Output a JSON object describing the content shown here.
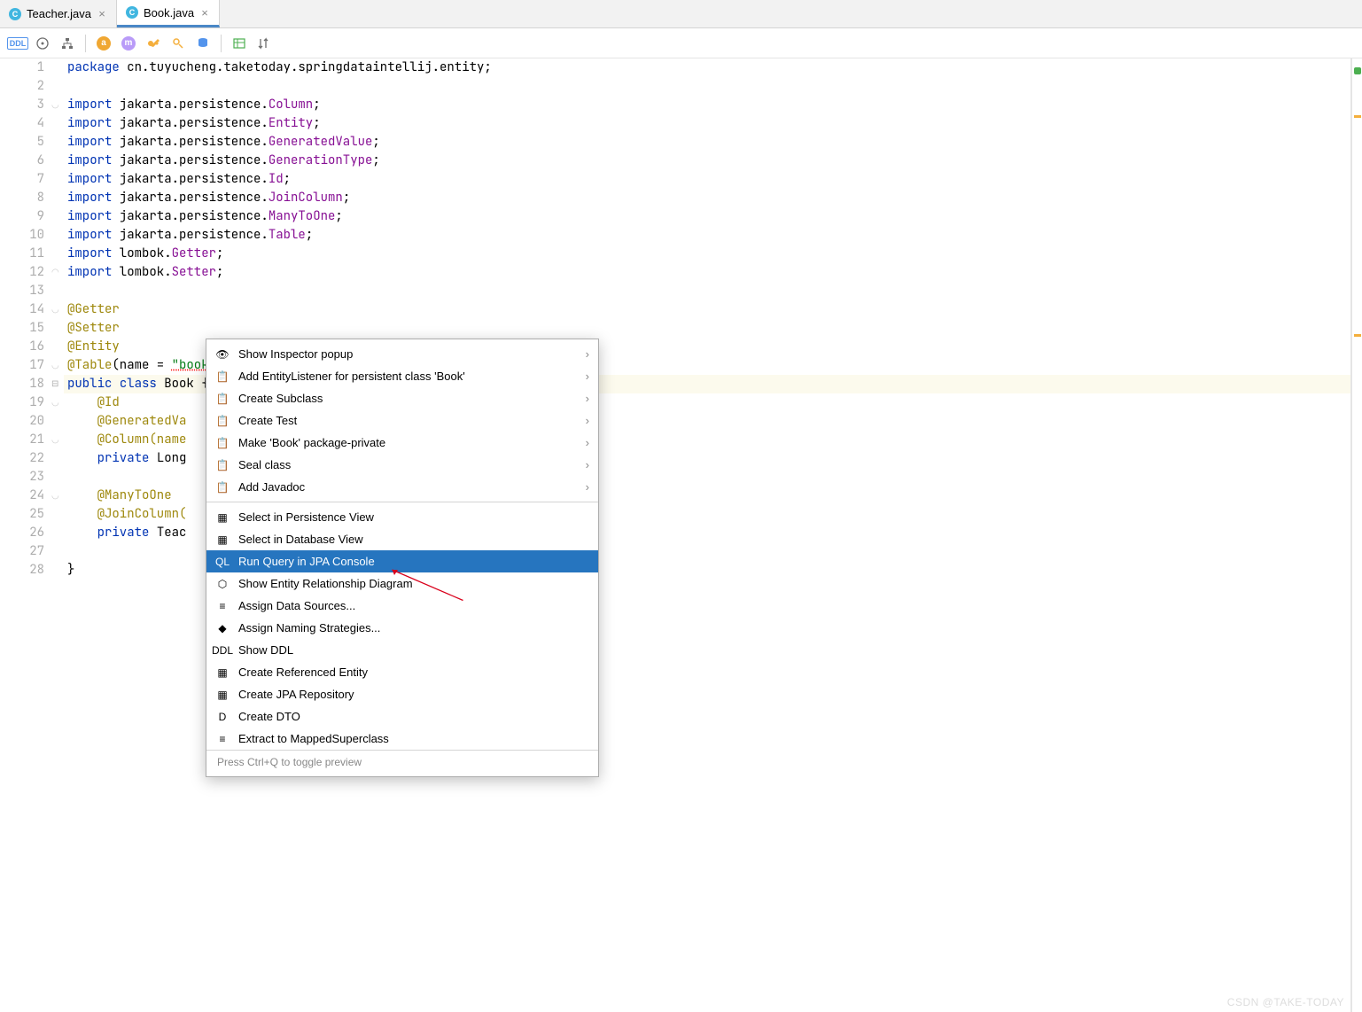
{
  "tabs": [
    {
      "icon": "C",
      "label": "Teacher.java",
      "active": false
    },
    {
      "icon": "C",
      "label": "Book.java",
      "active": true
    }
  ],
  "toolbar": {
    "ddl": "DDL"
  },
  "gutter_last": 28,
  "code": {
    "package_kw": "package",
    "package_val": " cn.tuyucheng.taketoday.springdataintellij.entity;",
    "import_kw": "import",
    "imports": [
      {
        "pkg": " jakarta.persistence.",
        "cls": "Column",
        "tail": ";"
      },
      {
        "pkg": " jakarta.persistence.",
        "cls": "Entity",
        "tail": ";"
      },
      {
        "pkg": " jakarta.persistence.",
        "cls": "GeneratedValue",
        "tail": ";"
      },
      {
        "pkg": " jakarta.persistence.",
        "cls": "GenerationType",
        "tail": ";"
      },
      {
        "pkg": " jakarta.persistence.",
        "cls": "Id",
        "tail": ";"
      },
      {
        "pkg": " jakarta.persistence.",
        "cls": "JoinColumn",
        "tail": ";"
      },
      {
        "pkg": " jakarta.persistence.",
        "cls": "ManyToOne",
        "tail": ";"
      },
      {
        "pkg": " jakarta.persistence.",
        "cls": "Table",
        "tail": ";"
      },
      {
        "pkg": " lombok.",
        "cls": "Getter",
        "tail": ";"
      },
      {
        "pkg": " lombok.",
        "cls": "Setter",
        "tail": ";"
      }
    ],
    "ann_getter": "@Getter",
    "ann_setter": "@Setter",
    "ann_entity": "@Entity",
    "ann_table_pre": "@Table",
    "ann_table_args_pre": "(name = ",
    "ann_table_str": "\"book\"",
    "ann_table_args_post": ")",
    "cls_decl_pre": "public class ",
    "cls_name": "Book",
    "cls_decl_post": " {",
    "ann_id": "    @Id",
    "ann_genval": "    @GeneratedVa",
    "ann_column": "    @Column(name",
    "priv_long": "    private Long",
    "ann_many": "    @ManyToOne",
    "ann_joincol": "    @JoinColumn(",
    "priv_teach": "    private Teac",
    "close_brace": "}",
    "private_kw": "private",
    "public_kw": "public",
    "class_kw": "class",
    "long_type": " Long",
    "teac_type": " Teac"
  },
  "menu": {
    "items_top": [
      {
        "icon": "👁",
        "label": "Show Inspector popup",
        "arrow": true
      },
      {
        "icon": "📋",
        "label": "Add EntityListener for persistent class 'Book'",
        "arrow": true
      },
      {
        "icon": "📋",
        "label": "Create Subclass",
        "arrow": true
      },
      {
        "icon": "📋",
        "label": "Create Test",
        "arrow": true
      },
      {
        "icon": "📋",
        "label": "Make 'Book' package-private",
        "arrow": true
      },
      {
        "icon": "📋",
        "label": "Seal class",
        "arrow": true
      },
      {
        "icon": "📋",
        "label": "Add Javadoc",
        "arrow": true
      }
    ],
    "items_mid": [
      {
        "icon": "▦",
        "label": "Select in Persistence View"
      },
      {
        "icon": "▦",
        "label": "Select in Database View"
      }
    ],
    "item_selected": {
      "icon": "QL",
      "label": "Run Query in JPA Console"
    },
    "items_bottom": [
      {
        "icon": "⬡",
        "label": "Show Entity Relationship Diagram"
      },
      {
        "icon": "≡",
        "label": "Assign Data Sources..."
      },
      {
        "icon": "◆",
        "label": "Assign Naming Strategies..."
      },
      {
        "icon": "DDL",
        "label": "Show DDL"
      },
      {
        "icon": "▦",
        "label": "Create Referenced Entity"
      },
      {
        "icon": "▦",
        "label": "Create JPA Repository"
      },
      {
        "icon": "D",
        "label": "Create DTO"
      },
      {
        "icon": "≡",
        "label": "Extract to MappedSuperclass"
      }
    ],
    "footer": "Press Ctrl+Q to toggle preview"
  },
  "watermark": "CSDN @TAKE-TODAY"
}
